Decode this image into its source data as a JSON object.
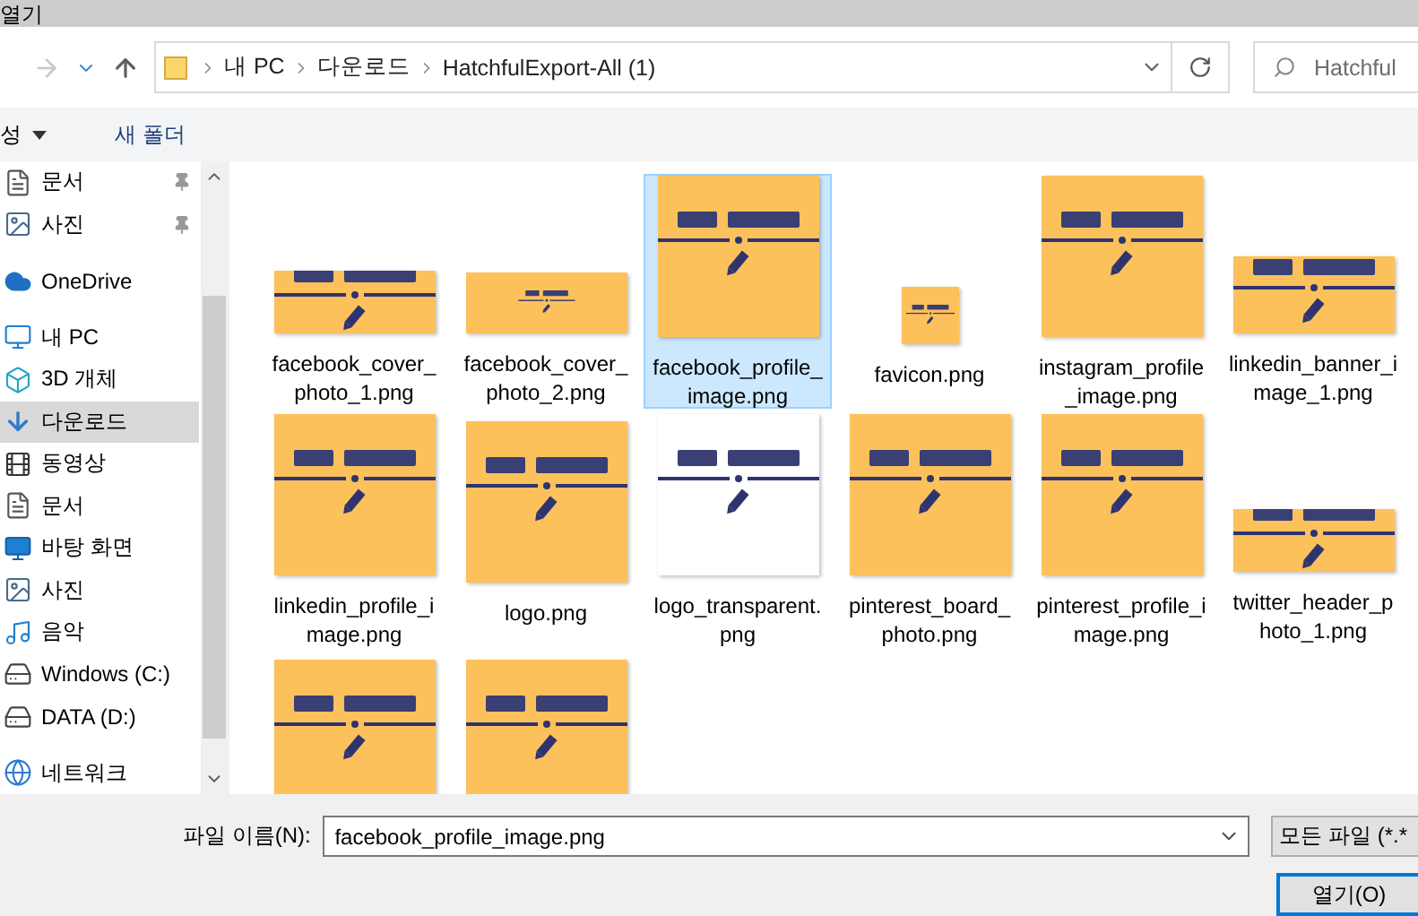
{
  "window": {
    "title": "열기"
  },
  "nav": {
    "breadcrumbs": [
      "내 PC",
      "다운로드",
      "HatchfulExport-All (1)"
    ],
    "search": {
      "placeholder": "Hatchful"
    }
  },
  "toolbar": {
    "organize": "성",
    "new_folder": "새 폴더"
  },
  "sidebar": {
    "items": [
      {
        "label": "문서",
        "kind": "document",
        "pinned": true,
        "selected": false
      },
      {
        "label": "사진",
        "pinned": true,
        "selected": false
      },
      {
        "label": "OneDrive",
        "kind": "cloud",
        "pinned": false,
        "selected": false
      },
      {
        "label": "내 PC",
        "kind": "computer",
        "pinned": false,
        "selected": false,
        "children": [
          {
            "label": "3D 개체",
            "kind": "cube",
            "selected": false
          },
          {
            "label": "다운로드",
            "kind": "download",
            "selected": true
          },
          {
            "label": "동영상",
            "kind": "film",
            "selected": false
          },
          {
            "label": "문서",
            "kind": "document",
            "selected": false
          },
          {
            "label": "바탕 화면",
            "kind": "desktop",
            "selected": false
          },
          {
            "label": "사진",
            "selected": false
          },
          {
            "label": "음악",
            "kind": "music",
            "selected": false
          },
          {
            "label": "Windows (C:)",
            "kind": "windrive",
            "selected": false
          },
          {
            "label": "DATA (D:)",
            "kind": "drive",
            "selected": false
          }
        ]
      },
      {
        "label": "네트워크",
        "kind": "network",
        "pinned": false,
        "selected": false
      }
    ]
  },
  "files": [
    {
      "name": "facebook_cover_photo_1.png",
      "kind": "wide",
      "selected": false
    },
    {
      "name": "facebook_cover_photo_2.png",
      "kind": "strip",
      "selected": false
    },
    {
      "name": "facebook_profile_image.png",
      "kind": "square",
      "selected": true
    },
    {
      "name": "favicon.png",
      "kind": "small",
      "selected": false
    },
    {
      "name": "instagram_profile_image.png",
      "kind": "square",
      "selected": false
    },
    {
      "name": "linkedin_banner_image_1.png",
      "kind": "banner",
      "selected": false
    },
    {
      "name": "linkedin_profile_image.png",
      "kind": "square",
      "selected": false
    },
    {
      "name": "logo.png",
      "kind": "square",
      "selected": false
    },
    {
      "name": "logo_transparent.png",
      "kind": "white",
      "selected": false
    },
    {
      "name": "pinterest_board_photo.png",
      "kind": "square",
      "selected": false
    },
    {
      "name": "pinterest_profile_image.png",
      "kind": "square",
      "selected": false
    },
    {
      "name": "twitter_header_photo_1.png",
      "kind": "wide",
      "selected": false
    },
    {
      "kind": "square",
      "selected": false
    },
    {
      "kind": "square",
      "selected": false
    }
  ],
  "footer": {
    "filename_label": "파일 이름(N):",
    "filename": "facebook_profile_image.png",
    "filter": "모든 파일 (*.*",
    "open_button": "열기(O)"
  }
}
